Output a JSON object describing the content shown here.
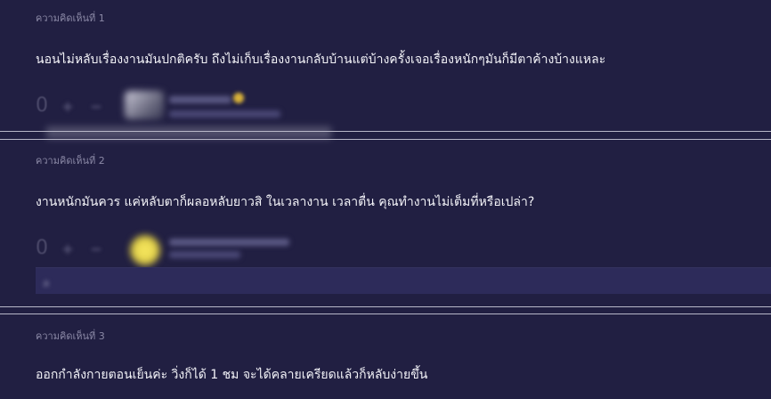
{
  "comments": [
    {
      "label": "ความคิดเห็นที่ 1",
      "text": "นอนไม่หลับเรื่องงานมันปกติครับ   ถึงไม่เก็บเรื่องงานกลับบ้านแต่บ้างครั้งเจอเรื่องหนักๆมันก็มีตาค้างบ้างแหละ",
      "votes": "0"
    },
    {
      "label": "ความคิดเห็นที่ 2",
      "text": "งานหนักมันควร แค่หลับตาก็ผลอหลับยาวสิ ในเวลางาน เวลาตื่น คุณทำงานไม่เต็มที่หรือเปล่า?",
      "votes": "0",
      "reply_preview": "ล"
    },
    {
      "label": "ความคิดเห็นที่ 3",
      "text": "ออกกำลังกายตอนเย็นค่ะ วิ่งก็ได้ 1 ชม จะได้คลายเครียดแล้วก็หลับง่ายขึ้น"
    }
  ],
  "icons": {
    "vote_up": "plus-icon",
    "vote_down": "minus-icon"
  },
  "colors": {
    "background": "#211f42",
    "text": "#f2f2f7",
    "label": "#8b89a6",
    "divider": "#b8b7c8"
  }
}
